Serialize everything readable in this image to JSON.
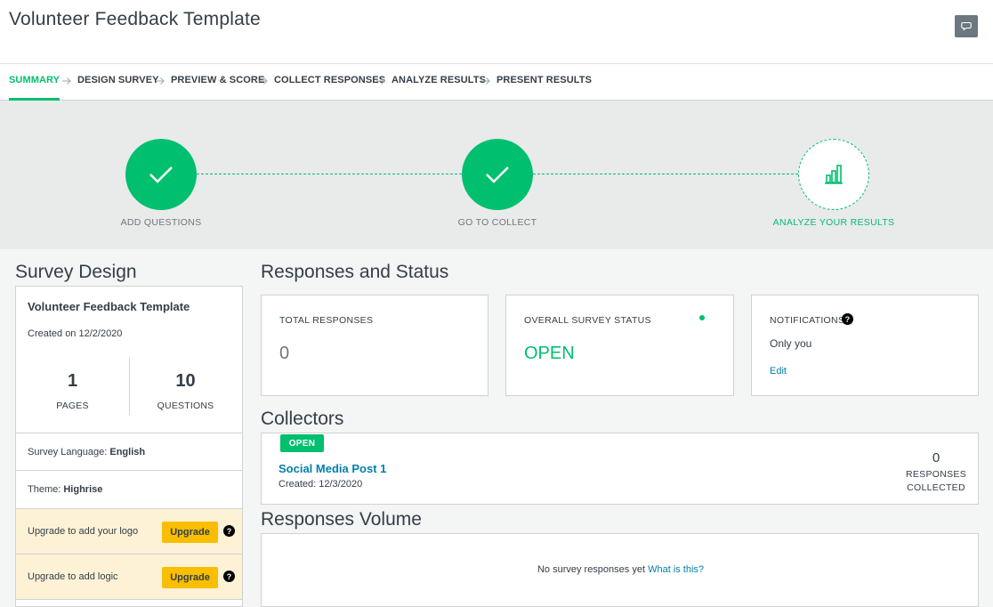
{
  "header": {
    "title": "Volunteer Feedback Template",
    "comment_icon": "comment-icon"
  },
  "nav": {
    "tabs": [
      {
        "label": "SUMMARY",
        "active": true
      },
      {
        "label": "DESIGN SURVEY",
        "active": false
      },
      {
        "label": "PREVIEW & SCORE",
        "active": false
      },
      {
        "label": "COLLECT RESPONSES",
        "active": false
      },
      {
        "label": "ANALYZE RESULTS",
        "active": false
      },
      {
        "label": "PRESENT RESULTS",
        "active": false
      }
    ]
  },
  "progress": {
    "steps": [
      {
        "label": "ADD QUESTIONS",
        "state": "done",
        "icon": "checkmark-icon"
      },
      {
        "label": "GO TO COLLECT",
        "state": "done",
        "icon": "checkmark-icon"
      },
      {
        "label": "ANALYZE YOUR RESULTS",
        "state": "todo",
        "icon": "bar-chart-icon"
      }
    ]
  },
  "survey_design": {
    "heading": "Survey Design",
    "name": "Volunteer Feedback Template",
    "created": "Created on 12/2/2020",
    "pages_count": "1",
    "pages_label": "PAGES",
    "questions_count": "10",
    "questions_label": "QUESTIONS",
    "language_label": "Survey Language:",
    "language_value": "English",
    "theme_label": "Theme:",
    "theme_value": "Highrise",
    "upsell_logo": "Upgrade to add your logo",
    "upsell_logic": "Upgrade to add logic",
    "upgrade_label": "Upgrade",
    "help_glyph": "?"
  },
  "responses_status": {
    "heading": "Responses and Status",
    "total_label": "TOTAL RESPONSES",
    "total_value": "0",
    "status_label": "OVERALL SURVEY STATUS",
    "status_value": "OPEN",
    "notifications_label": "NOTIFICATIONS",
    "notifications_value": "Only you",
    "edit_label": "Edit"
  },
  "collectors": {
    "heading": "Collectors",
    "items": [
      {
        "badge": "OPEN",
        "name": "Social Media Post 1",
        "created": "Created: 12/3/2020",
        "responses": "0",
        "responses_label_1": "RESPONSES",
        "responses_label_2": "COLLECTED"
      }
    ]
  },
  "volume": {
    "heading": "Responses Volume",
    "message": "No survey responses yet",
    "link": "What is this?"
  },
  "colors": {
    "accent": "#00bf6f",
    "link": "#007faa",
    "upgrade": "#f9be00",
    "upsell_bg": "#fdf2d5"
  }
}
